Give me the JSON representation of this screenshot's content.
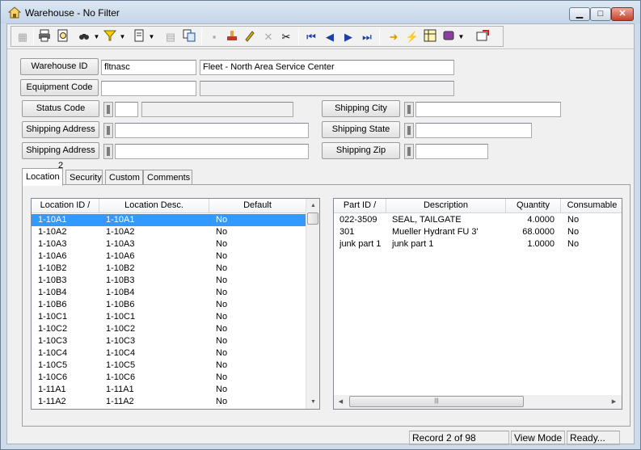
{
  "window": {
    "title": "Warehouse - No Filter",
    "controls": {
      "minimize": "▁",
      "maximize": "□",
      "close": "✕"
    }
  },
  "toolbar": {
    "icons": [
      "new-record-icon",
      "print-icon",
      "print-preview-icon",
      "find-icon",
      "filter-icon",
      "new-document-icon",
      "properties-icon",
      "copy-icon",
      "save-icon",
      "stamp-icon",
      "edit-icon",
      "delete-icon",
      "cut-icon",
      "first-record-icon",
      "previous-record-icon",
      "next-record-icon",
      "last-record-icon",
      "jump-icon",
      "lightning-icon",
      "grid-icon",
      "report-icon",
      "exit-icon"
    ]
  },
  "form": {
    "warehouse_id_label": "Warehouse ID",
    "warehouse_id_value": "fltnasc",
    "warehouse_desc_value": "Fleet - North Area Service Center",
    "equipment_code_label": "Equipment Code",
    "equipment_code_value": "",
    "equipment_desc_value": "",
    "status_code_label": "Status Code",
    "status_code_value": "",
    "status_desc_value": "",
    "shipping_address_label": "Shipping Address",
    "shipping_address_value": "",
    "shipping_address2_label": "Shipping Address 2",
    "shipping_address2_value": "",
    "shipping_city_label": "Shipping City",
    "shipping_city_value": "",
    "shipping_state_label": "Shipping State",
    "shipping_state_value": "",
    "shipping_zip_label": "Shipping Zip",
    "shipping_zip_value": ""
  },
  "tabs": [
    {
      "label": "Location",
      "active": true
    },
    {
      "label": "Security",
      "active": false
    },
    {
      "label": "Custom",
      "active": false
    },
    {
      "label": "Comments",
      "active": false
    }
  ],
  "locations_grid": {
    "columns": [
      "Location ID /",
      "Location Desc.",
      "Default"
    ],
    "rows": [
      {
        "id": "1-10A1",
        "desc": "1-10A1",
        "default": "No",
        "selected": true
      },
      {
        "id": "1-10A2",
        "desc": "1-10A2",
        "default": "No",
        "selected": false
      },
      {
        "id": "1-10A3",
        "desc": "1-10A3",
        "default": "No",
        "selected": false
      },
      {
        "id": "1-10A6",
        "desc": "1-10A6",
        "default": "No",
        "selected": false
      },
      {
        "id": "1-10B2",
        "desc": "1-10B2",
        "default": "No",
        "selected": false
      },
      {
        "id": "1-10B3",
        "desc": "1-10B3",
        "default": "No",
        "selected": false
      },
      {
        "id": "1-10B4",
        "desc": "1-10B4",
        "default": "No",
        "selected": false
      },
      {
        "id": "1-10B6",
        "desc": "1-10B6",
        "default": "No",
        "selected": false
      },
      {
        "id": "1-10C1",
        "desc": "1-10C1",
        "default": "No",
        "selected": false
      },
      {
        "id": "1-10C2",
        "desc": "1-10C2",
        "default": "No",
        "selected": false
      },
      {
        "id": "1-10C3",
        "desc": "1-10C3",
        "default": "No",
        "selected": false
      },
      {
        "id": "1-10C4",
        "desc": "1-10C4",
        "default": "No",
        "selected": false
      },
      {
        "id": "1-10C5",
        "desc": "1-10C5",
        "default": "No",
        "selected": false
      },
      {
        "id": "1-10C6",
        "desc": "1-10C6",
        "default": "No",
        "selected": false
      },
      {
        "id": "1-11A1",
        "desc": "1-11A1",
        "default": "No",
        "selected": false
      },
      {
        "id": "1-11A2",
        "desc": "1-11A2",
        "default": "No",
        "selected": false
      }
    ]
  },
  "parts_grid": {
    "columns": [
      "Part ID /",
      "Description",
      "Quantity",
      "Consumable"
    ],
    "rows": [
      {
        "part_id": "022-3509",
        "description": "SEAL, TAILGATE",
        "quantity": "4.0000",
        "consumable": "No"
      },
      {
        "part_id": "301",
        "description": "Mueller Hydrant FU 3'",
        "quantity": "68.0000",
        "consumable": "No"
      },
      {
        "part_id": "junk part 1",
        "description": "junk part 1",
        "quantity": "1.0000",
        "consumable": "No"
      }
    ]
  },
  "status": {
    "record": "Record 2 of 98",
    "mode": "View Mode",
    "state": "Ready..."
  },
  "colors": {
    "selection": "#3399ff",
    "accent": "#0a246a"
  }
}
